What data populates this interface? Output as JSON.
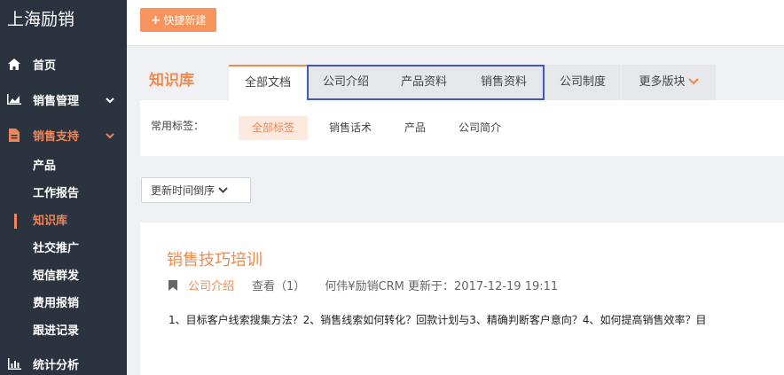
{
  "sidebar": {
    "brand": "上海励销",
    "items": [
      {
        "label": "首页",
        "icon": "home-icon"
      },
      {
        "label": "销售管理",
        "icon": "chart-area-icon"
      },
      {
        "label": "销售支持",
        "icon": "file-icon"
      },
      {
        "label": "统计分析",
        "icon": "bar-chart-icon"
      }
    ],
    "subitems": [
      "产品",
      "工作报告",
      "知识库",
      "社交推广",
      "短信群发",
      "费用报销",
      "跟进记录"
    ],
    "active_subitem": "知识库"
  },
  "toolbar": {
    "quick_new_label": "快捷新建"
  },
  "kb": {
    "title": "知识库",
    "tabs": [
      "全部文档",
      "公司介绍",
      "产品资料",
      "销售资料",
      "公司制度",
      "更多版块"
    ],
    "tags_label": "常用标签：",
    "tags": [
      "全部标签",
      "销售话术",
      "产品",
      "公司简介"
    ],
    "sort_label": "更新时间倒序"
  },
  "article": {
    "title": "销售技巧培训",
    "category": "公司介绍",
    "views": "查看（1）",
    "author_update": "何伟¥励销CRM 更新于：2017-12-19 19:11",
    "summary": "1、目标客户线索搜集方法？2、销售线索如何转化？回款计划与3、精确判断客户意向？4、如何提高销售效率？目"
  },
  "colors": {
    "accent": "#f28a4e",
    "sidebar_bg": "#2b333e",
    "highlight_border": "#3b5ac8"
  }
}
